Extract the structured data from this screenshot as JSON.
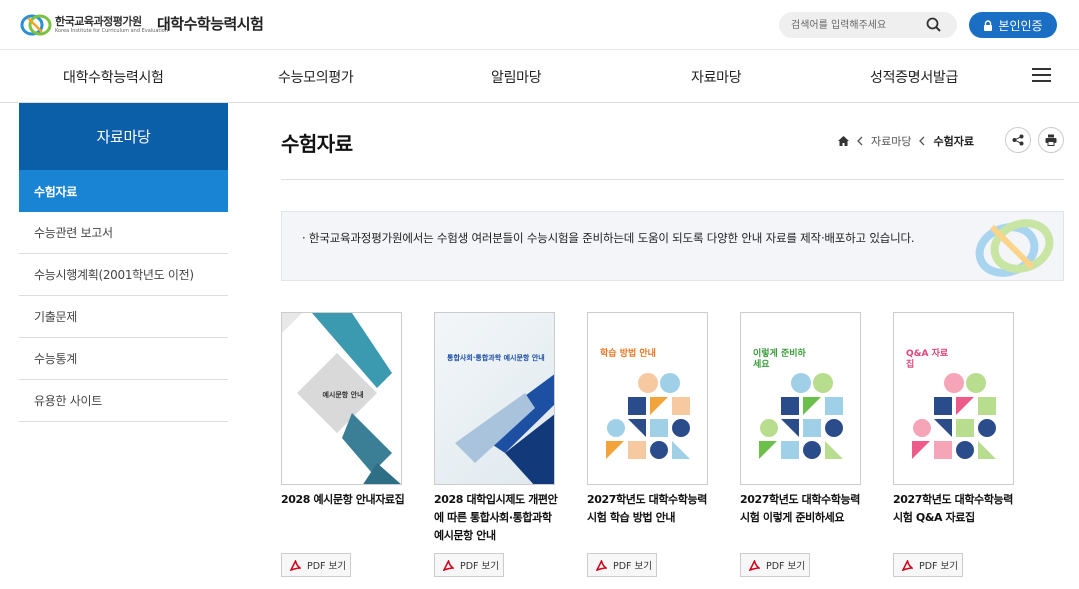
{
  "header": {
    "org_name": "한국교육과정평가원",
    "org_sub": "Korea Institute for Curriculum and Evaluation",
    "site_title": "대학수학능력시험",
    "search_placeholder": "검색어를 입력해주세요",
    "auth_label": "본인인증"
  },
  "gnb": [
    "대학수학능력시험",
    "수능모의평가",
    "알림마당",
    "자료마당",
    "성적증명서발급"
  ],
  "sidebar": {
    "title": "자료마당",
    "items": [
      {
        "label": "수험자료",
        "active": true
      },
      {
        "label": "수능관련 보고서"
      },
      {
        "label": "수능시행계획(2001학년도 이전)"
      },
      {
        "label": "기출문제"
      },
      {
        "label": "수능통계"
      },
      {
        "label": "유용한 사이트"
      }
    ]
  },
  "main": {
    "title": "수험자료",
    "breadcrumb": [
      "자료마당",
      "수험자료"
    ],
    "notice": "· 한국교육과정평가원에서는 수험생 여러분들이 수능시험을 준비하는데 도움이 되도록 다양한 안내 자료를 제작·배포하고 있습니다.",
    "pdf_label": "PDF 보기",
    "cards": [
      {
        "title": "2028 예시문항 안내자료집",
        "cover_title": "예시문항 안내"
      },
      {
        "title": "2028 대학입시제도 개편안에 따른 통합사회·통합과학 예시문항 안내",
        "cover_title": "통합사회·통합과학 예시문항 안내"
      },
      {
        "title": "2027학년도 대학수학능력시험 학습 방법 안내",
        "cover_title": "학습 방법 안내"
      },
      {
        "title": "2027학년도 대학수학능력시험 이렇게 준비하세요",
        "cover_title": "이렇게 준비하세요"
      },
      {
        "title": "2027학년도 대학수학능력시험 Q&A 자료집",
        "cover_title": "Q&A 자료집"
      }
    ]
  },
  "colors": {
    "primary": "#0b5ea8",
    "active": "#1a84d4",
    "button": "#1a6fc4",
    "pdf_red": "#d0021b"
  },
  "icons": [
    "search-icon",
    "lock-icon",
    "menu-icon",
    "home-icon",
    "chevron-left-icon",
    "share-icon",
    "print-icon",
    "pdf-icon"
  ]
}
